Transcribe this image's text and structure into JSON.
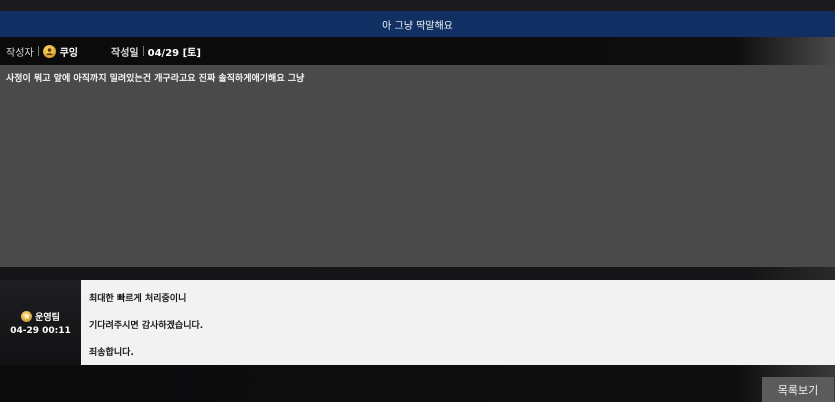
{
  "post": {
    "title": "아 그냥 딱말해요",
    "author_label": "작성자",
    "author": "쿠잉",
    "date_label": "작성일",
    "date": "04/29 [토]",
    "body": "사정이 뭐고 앞에 아직까지 밀려있는건 개구라고요 진짜 솔직하게애기해요 그냥"
  },
  "comment": {
    "author": "운영팀",
    "timestamp": "04-29 00:11",
    "lines": [
      "최대한 빠르게 처리중이니",
      "기다려주시면 감사하겠습니다.",
      "죄송합니다."
    ]
  },
  "actions": {
    "list_label": "목록보기"
  },
  "colors": {
    "title_bar": "#103063",
    "content_bg": "#4a4a4a",
    "comment_bg": "#f2f2f2",
    "button_bg": "#5b5b5b"
  },
  "icons": {
    "author_icon": "user-badge-icon",
    "admin_icon": "admin-star-icon"
  }
}
